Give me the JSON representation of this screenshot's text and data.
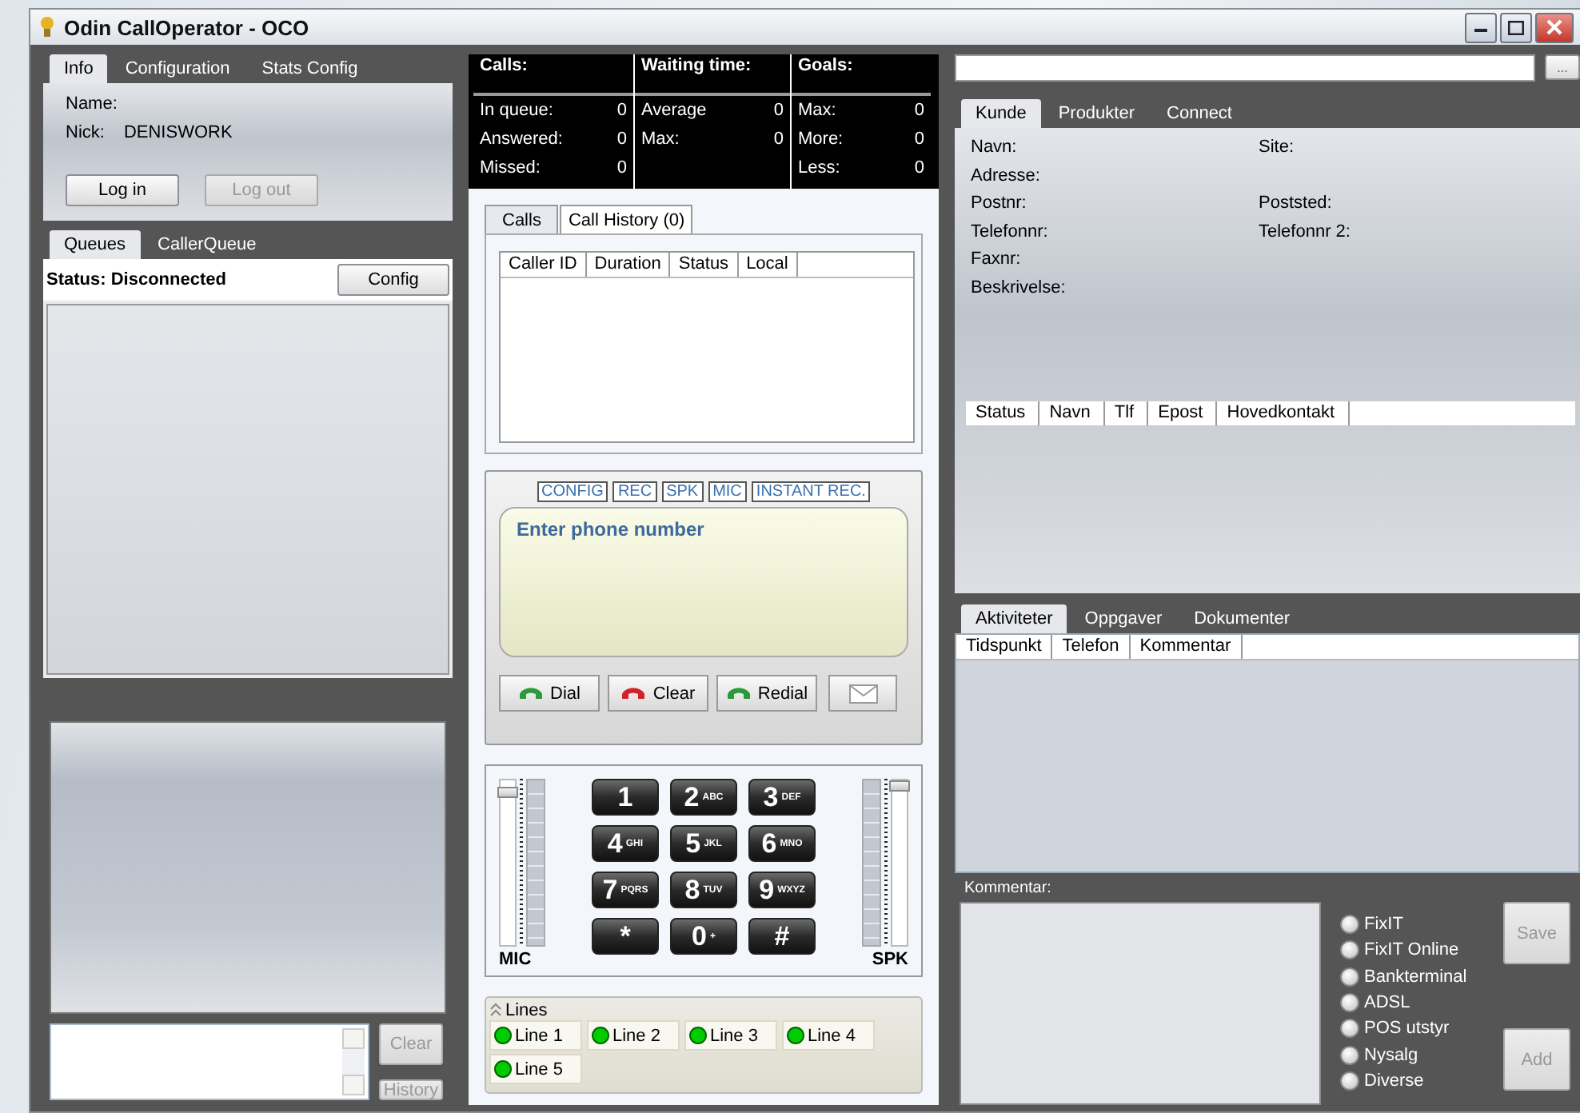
{
  "window": {
    "title": "Odin CallOperator - OCO"
  },
  "info_tabs": [
    {
      "label": "Info",
      "selected": true
    },
    {
      "label": "Configuration",
      "selected": false
    },
    {
      "label": "Stats Config",
      "selected": false
    }
  ],
  "info": {
    "fields": [
      {
        "label": "Name:"
      },
      {
        "label": "Nick:",
        "value": "DENISWORK"
      }
    ],
    "buttons": [
      {
        "label": "Log in",
        "disabled": false
      },
      {
        "label": "Log out",
        "disabled": true
      }
    ]
  },
  "queue_tabs": [
    {
      "label": "Queues",
      "selected": true
    },
    {
      "label": "CallerQueue",
      "selected": false
    }
  ],
  "queue": {
    "status": "Status: Disconnected",
    "config_button": "Config"
  },
  "chat": {
    "buttons": [
      {
        "label": "Clear",
        "disabled": true
      },
      {
        "label": "History",
        "disabled": true
      }
    ]
  },
  "stats": {
    "columns": [
      {
        "title": "Calls:",
        "rows": [
          {
            "label": "In queue:",
            "value": "0"
          },
          {
            "label": "Answered:",
            "value": "0"
          },
          {
            "label": "Missed:",
            "value": "0"
          }
        ]
      },
      {
        "title": "Waiting time:",
        "rows": [
          {
            "label": "Average",
            "value": "0"
          },
          {
            "label": "Max:",
            "value": "0"
          }
        ]
      },
      {
        "title": "Goals:",
        "rows": [
          {
            "label": "Max:",
            "value": "0"
          },
          {
            "label": "More:",
            "value": "0"
          },
          {
            "label": "Less:",
            "value": "0"
          }
        ]
      }
    ]
  },
  "call_tabs": [
    {
      "label": "Calls",
      "selected": true
    },
    {
      "label": "Call History (0)",
      "selected": false
    }
  ],
  "calls_table": {
    "columns": [
      "Caller ID",
      "Duration",
      "Status",
      "Local"
    ]
  },
  "phone": {
    "toggles": [
      "CONFIG",
      "REC",
      "SPK",
      "MIC",
      "INSTANT REC."
    ],
    "display": {
      "placeholder": "Enter phone number"
    },
    "buttons": [
      {
        "label": "Dial",
        "kind": "dial"
      },
      {
        "label": "Clear",
        "kind": "hangup"
      },
      {
        "label": "Redial",
        "kind": "dial"
      },
      {
        "kind": "message"
      }
    ]
  },
  "keypad": {
    "mic": {
      "label": "MIC",
      "level": 0.96
    },
    "spk": {
      "label": "SPK",
      "level": 1
    },
    "keys": [
      {
        "digit": "1"
      },
      {
        "digit": "2",
        "letters": "ABC"
      },
      {
        "digit": "3",
        "letters": "DEF"
      },
      {
        "digit": "4",
        "letters": "GHI"
      },
      {
        "digit": "5",
        "letters": "JKL"
      },
      {
        "digit": "6",
        "letters": "MNO"
      },
      {
        "digit": "7",
        "letters": "PQRS"
      },
      {
        "digit": "8",
        "letters": "TUV"
      },
      {
        "digit": "9",
        "letters": "WXYZ"
      },
      {
        "digit": "*"
      },
      {
        "digit": "0",
        "letters": "+"
      },
      {
        "digit": "#"
      }
    ]
  },
  "lines": {
    "title": "Lines",
    "items": [
      "Line 1",
      "Line 2",
      "Line 3",
      "Line 4",
      "Line 5"
    ]
  },
  "search": {
    "button": "..."
  },
  "customer_tabs": [
    {
      "label": "Kunde",
      "selected": true
    },
    {
      "label": "Produkter",
      "selected": false
    },
    {
      "label": "Connect",
      "selected": false
    }
  ],
  "customer": {
    "rows": [
      [
        "Navn:",
        "Site:"
      ],
      [
        "Adresse:"
      ],
      [
        "Postnr:",
        "Poststed:"
      ],
      [
        "Telefonnr:",
        "Telefonnr 2:"
      ],
      [
        "Faxnr:"
      ],
      [
        "Beskrivelse:"
      ]
    ]
  },
  "contacts_table": {
    "columns": [
      "Status",
      "Navn",
      "Tlf",
      "Epost",
      "Hovedkontakt"
    ]
  },
  "activity_tabs": [
    {
      "label": "Aktiviteter",
      "selected": true
    },
    {
      "label": "Oppgaver",
      "selected": false
    },
    {
      "label": "Dokumenter",
      "selected": false
    }
  ],
  "activity_table": {
    "columns": [
      "Tidspunkt",
      "Telefon",
      "Kommentar"
    ]
  },
  "comment": {
    "label": "Kommentar:"
  },
  "categories": [
    {
      "label": "FixIT",
      "selected": false
    },
    {
      "label": "FixIT Online",
      "selected": false
    },
    {
      "label": "Bankterminal",
      "selected": false
    },
    {
      "label": "ADSL",
      "selected": false
    },
    {
      "label": "POS utstyr",
      "selected": false
    },
    {
      "label": "Nysalg",
      "selected": false
    },
    {
      "label": "Diverse",
      "selected": false
    }
  ],
  "action_buttons": [
    {
      "label": "Save",
      "disabled": true
    },
    {
      "label": "Add",
      "disabled": true
    }
  ]
}
